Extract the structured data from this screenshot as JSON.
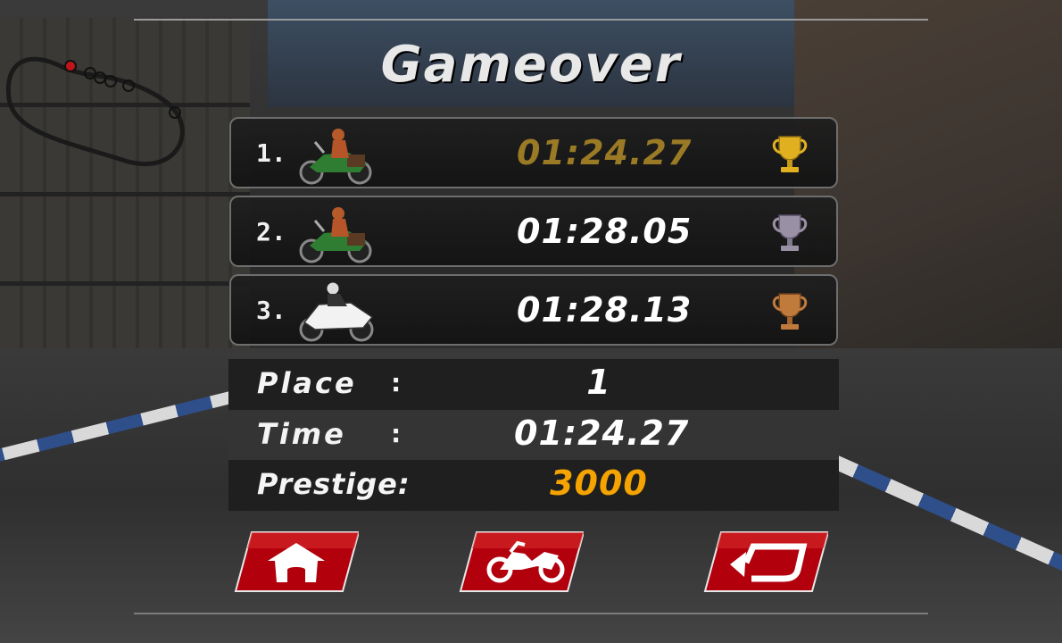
{
  "title": "Gameover",
  "rankings": [
    {
      "rank": "1.",
      "time": "01:24.27",
      "time_color": "gold",
      "trophy": "gold-trophy-icon",
      "rider": "green-chopper-bike-icon"
    },
    {
      "rank": "2.",
      "time": "01:28.05",
      "time_color": "white",
      "trophy": "silver-trophy-icon",
      "rider": "green-chopper-bike-icon"
    },
    {
      "rank": "3.",
      "time": "01:28.13",
      "time_color": "white",
      "trophy": "bronze-trophy-icon",
      "rider": "white-sport-bike-icon"
    }
  ],
  "stats": {
    "place": {
      "label": "Place",
      "colon": ":",
      "value": "1"
    },
    "time": {
      "label": "Time",
      "colon": ":",
      "value": "01:24.27"
    },
    "prestige": {
      "label": "Prestige:",
      "value": "3000"
    }
  },
  "buttons": {
    "home": "home-icon",
    "garage": "motorcycle-icon",
    "restart": "restart-arrow-icon"
  },
  "colors": {
    "gold_time": "#9a7a25",
    "prestige": "#f5a300",
    "button_red": "#b3000d"
  }
}
